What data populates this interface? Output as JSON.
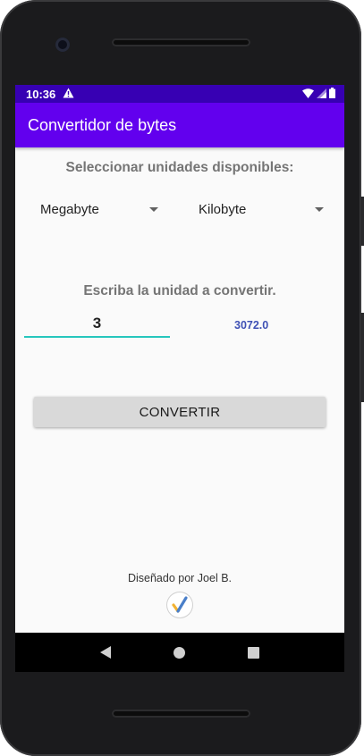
{
  "status_bar": {
    "time": "10:36"
  },
  "app_bar": {
    "title": "Convertidor de bytes"
  },
  "main": {
    "select_heading": "Seleccionar unidades disponibles:",
    "from_unit": "Megabyte",
    "to_unit": "Kilobyte",
    "input_heading": "Escriba la unidad a convertir.",
    "input_value": "3",
    "result_value": "3072.0",
    "convert_button": "CONVERTIR",
    "footer_text": "Diseñado por Joel B."
  },
  "colors": {
    "status_bar": "#3700b3",
    "app_bar": "#6200ee",
    "input_underline": "#26c6bd",
    "result_text": "#3f51b5"
  },
  "icons": [
    "warning-icon",
    "wifi-icon",
    "cell-signal-icon",
    "battery-icon",
    "dropdown-caret-icon",
    "checkmark-logo-icon",
    "back-icon",
    "home-icon",
    "recents-icon"
  ]
}
